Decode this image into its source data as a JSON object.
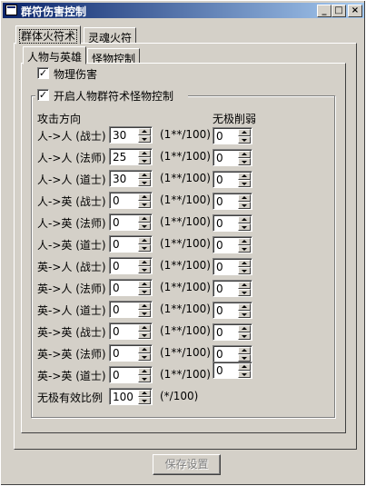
{
  "window": {
    "title": "群符伤害控制",
    "min_icon": "minimize-icon",
    "max_icon": "maximize-icon",
    "close_icon": "close-icon"
  },
  "outer_tabs": [
    {
      "label": "群体火符术",
      "active": true
    },
    {
      "label": "灵魂火符",
      "active": false
    }
  ],
  "inner_tabs": [
    {
      "label": "人物与英雄",
      "active": true
    },
    {
      "label": "怪物控制",
      "active": false
    }
  ],
  "physical_damage": {
    "label": "物理伤害",
    "checked": "✓"
  },
  "group": {
    "label": "开启人物群符术怪物控制",
    "checked": "✓"
  },
  "headers": {
    "attack_direction": "攻击方向",
    "wuji": "无极削弱"
  },
  "rows": [
    {
      "label": "人->人 (战士)",
      "value": "30",
      "unit": "(1**/100)",
      "wuji": "0"
    },
    {
      "label": "人->人 (法师)",
      "value": "25",
      "unit": "(1**/100)",
      "wuji": "0"
    },
    {
      "label": "人->人 (道士)",
      "value": "30",
      "unit": "(1**/100)",
      "wuji": "0"
    },
    {
      "label": "人->英 (战士)",
      "value": "0",
      "unit": "(1**/100)",
      "wuji": "0"
    },
    {
      "label": "人->英 (法师)",
      "value": "0",
      "unit": "(1**/100)",
      "wuji": "0"
    },
    {
      "label": "人->英 (道士)",
      "value": "0",
      "unit": "(1**/100)",
      "wuji": "0"
    },
    {
      "label": "英->人 (战士)",
      "value": "0",
      "unit": "(1**/100)",
      "wuji": "0"
    },
    {
      "label": "英->人 (法师)",
      "value": "0",
      "unit": "(1**/100)",
      "wuji": "0"
    },
    {
      "label": "英->人 (道士)",
      "value": "0",
      "unit": "(1**/100)",
      "wuji": "0"
    },
    {
      "label": "英->英 (战士)",
      "value": "0",
      "unit": "(1**/100)",
      "wuji": "0"
    },
    {
      "label": "英->英 (法师)",
      "value": "0",
      "unit": "(1**/100)",
      "wuji": "0"
    },
    {
      "label": "英->英 (道士)",
      "value": "0",
      "unit": "(1**/100)",
      "wuji": "0"
    }
  ],
  "wuji_ratio": {
    "label": "无极有效比例",
    "value": "100",
    "unit": "(*/100)"
  },
  "save_button": {
    "label": "保存设置"
  }
}
